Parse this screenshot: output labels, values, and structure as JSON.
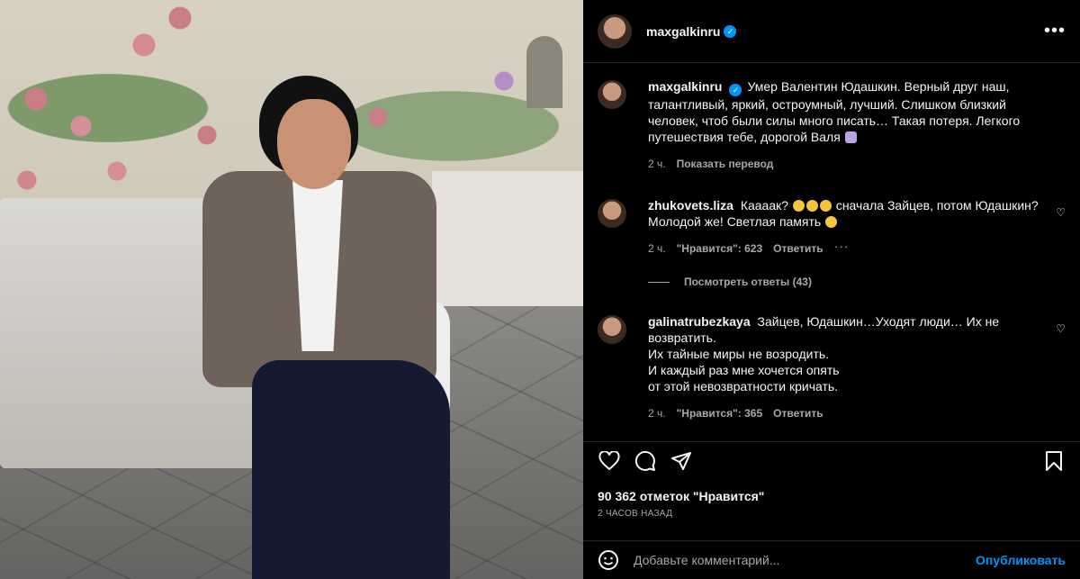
{
  "post": {
    "author": "maxgalkinru",
    "more_glyph": "•••"
  },
  "caption": {
    "username": "maxgalkinru",
    "text": "Умер Валентин Юдашкин. Верный друг наш, талантливый, яркий, остроумный, лучший. Слишком близкий человек, чтоб были силы много писать… Такая потеря. Легкого путешествия тебе, дорогой Валя",
    "time": "2 ч.",
    "translate": "Показать перевод"
  },
  "comments": [
    {
      "username": "zhukovets.liza",
      "text_before": "Кааaак?",
      "text_after": "сначала Зайцев, потом Юдашкин? Молодой же! Светлая память",
      "time": "2 ч.",
      "likes": "\"Нравится\": 623",
      "reply": "Ответить",
      "view_replies": "Посмотреть ответы (43)"
    },
    {
      "username": "galinatrubezkaya",
      "line1": "Зайцев, Юдашкин…Уходят люди… Их не возвратить.",
      "line2": "Их тайные миры не возродить.",
      "line3": "И каждый раз мне хочется опять",
      "line4": "от этой невозвратности кричать.",
      "time": "2 ч.",
      "likes": "\"Нравится\": 365",
      "reply": "Ответить"
    }
  ],
  "stats": {
    "likes": "90 362 отметок \"Нравится\"",
    "timestamp": "2 ЧАСОВ НАЗАД"
  },
  "add_comment": {
    "placeholder": "Добавьте комментарий...",
    "post_label": "Опубликовать"
  },
  "colors": {
    "background": "#000000",
    "text": "#f5f5f5",
    "secondary_text": "#a8a8a8",
    "accent": "#0095f6",
    "divider": "#262626"
  },
  "icons": [
    "heart-icon",
    "comment-icon",
    "share-icon",
    "bookmark-icon",
    "emoji-icon",
    "verified-icon",
    "more-icon"
  ]
}
